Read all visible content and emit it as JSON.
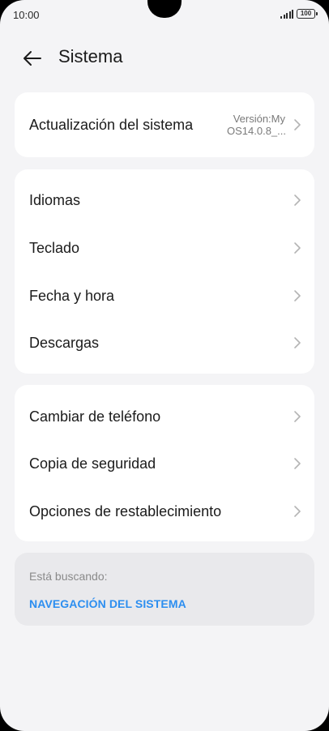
{
  "status_bar": {
    "time": "10:00",
    "battery": "100"
  },
  "header": {
    "title": "Sistema"
  },
  "update_card": {
    "label": "Actualización del sistema",
    "version_line1": "Versión:My",
    "version_line2": "OS14.0.8_..."
  },
  "group1": {
    "items": [
      {
        "label": "Idiomas"
      },
      {
        "label": "Teclado"
      },
      {
        "label": "Fecha y hora"
      },
      {
        "label": "Descargas"
      }
    ]
  },
  "group2": {
    "items": [
      {
        "label": "Cambiar de teléfono"
      },
      {
        "label": "Copia de seguridad"
      },
      {
        "label": "Opciones de restablecimiento"
      }
    ]
  },
  "suggestion": {
    "label": "Está buscando:",
    "link": "NAVEGACIÓN DEL SISTEMA"
  },
  "colors": {
    "background": "#f4f4f6",
    "card": "#ffffff",
    "suggestion_card": "#e9e9ec",
    "link": "#2c8ef0"
  }
}
